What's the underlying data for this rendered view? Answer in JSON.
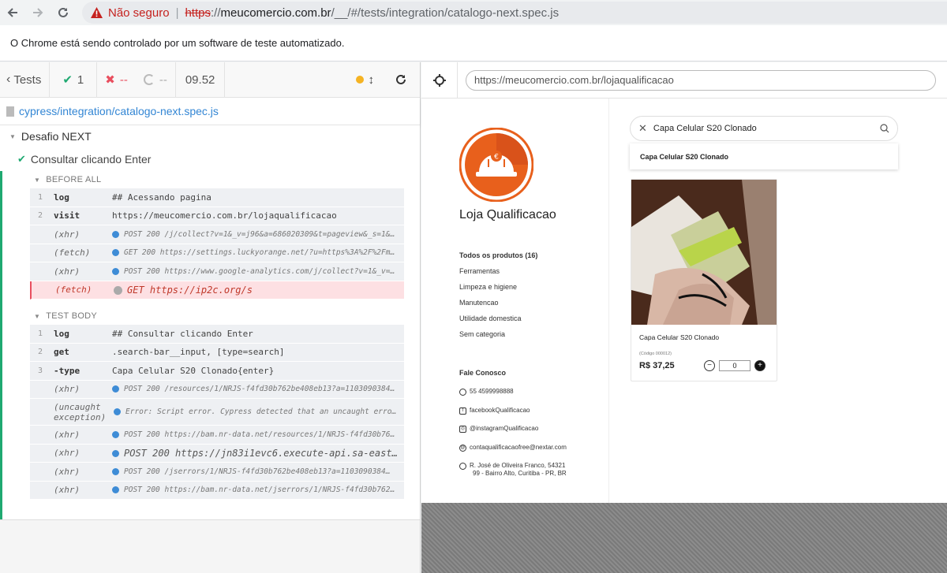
{
  "browser": {
    "security_label": "Não seguro",
    "url_proto": "https",
    "url_sep": "://",
    "url_host": "meucomercio.com.br",
    "url_path": "/__/#/tests/integration/catalogo-next.spec.js"
  },
  "infobar": {
    "text": "O Chrome está sendo controlado por um software de teste automatizado."
  },
  "reporter": {
    "tests_label": "Tests",
    "passed": "1",
    "failed": "--",
    "pending": "--",
    "duration": "09.52",
    "spec_path": "cypress/integration/catalogo-next.spec.js",
    "suite": "Desafio NEXT",
    "test": "Consultar clicando Enter",
    "before_all": "BEFORE ALL",
    "test_body": "TEST BODY",
    "before_cmds": [
      {
        "num": "1",
        "name": "log",
        "msg": "## Acessando pagina"
      },
      {
        "num": "2",
        "name": "visit",
        "msg": "https://meucomercio.com.br/lojaqualificacao"
      },
      {
        "num": "",
        "name": "(xhr)",
        "msg": "POST 200 /j/collect?v=1&_v=j96&a=686020309&t=pageview&_s=1&…"
      },
      {
        "num": "",
        "name": "(fetch)",
        "msg": "GET 200 https://settings.luckyorange.net/?u=https%3A%2F%2Fm…"
      },
      {
        "num": "",
        "name": "(xhr)",
        "msg": "POST 200 https://www.google-analytics.com/j/collect?v=1&_v=…"
      },
      {
        "num": "",
        "name": "(fetch)",
        "msg": "GET https://ip2c.org/s"
      }
    ],
    "body_cmds": [
      {
        "num": "1",
        "name": "log",
        "msg": "## Consultar clicando Enter"
      },
      {
        "num": "2",
        "name": "get",
        "msg": ".search-bar__input, [type=search]"
      },
      {
        "num": "3",
        "name": "-type",
        "msg": "Capa Celular S20 Clonado{enter}"
      },
      {
        "num": "",
        "name": "(xhr)",
        "msg": "POST 200 /resources/1/NRJS-f4fd30b762be408eb13?a=1103090384…"
      },
      {
        "num": "",
        "name": "(uncaught exception)",
        "msg": "Error: Script error. Cypress detected that an uncaught error w…"
      },
      {
        "num": "",
        "name": "(xhr)",
        "msg": "POST 200 https://bam.nr-data.net/resources/1/NRJS-f4fd30b76…"
      },
      {
        "num": "",
        "name": "(xhr)",
        "msg": "POST 200 https://jn83i1evc6.execute-api.sa-east-1.…"
      },
      {
        "num": "",
        "name": "(xhr)",
        "msg": "POST 200 /jserrors/1/NRJS-f4fd30b762be408eb13?a=1103090384…"
      },
      {
        "num": "",
        "name": "(xhr)",
        "msg": "POST 200 https://bam.nr-data.net/jserrors/1/NRJS-f4fd30b762…"
      }
    ]
  },
  "aut": {
    "url": "https://meucomercio.com.br/lojaqualificacao",
    "store_name": "Loja Qualificacao",
    "categories": [
      "Todos os produtos (16)",
      "Ferramentas",
      "Limpeza e higiene",
      "Manutencao",
      "Utilidade domestica",
      "Sem categoria"
    ],
    "contact_title": "Fale Conosco",
    "contacts": [
      "55 4599998888",
      "facebookQualificacao",
      "@instagramQualificacao",
      "contaqualificacaofree@nextar.com",
      "R. José de Oliveira Franco, 54321",
      "99 - Bairro Alto, Curitiba - PR, BR"
    ],
    "search_value": "Capa Celular S20 Clonado",
    "suggestion": "Capa Celular S20 Clonado",
    "product": {
      "title": "Capa Celular S20 Clonado",
      "code": "(Código 000012)",
      "price": "R$ 37,25",
      "qty": "0"
    }
  },
  "colors": {
    "brand_orange": "#e8601c",
    "cypress_green": "#1fa971",
    "fail_red": "#e94f5f"
  }
}
